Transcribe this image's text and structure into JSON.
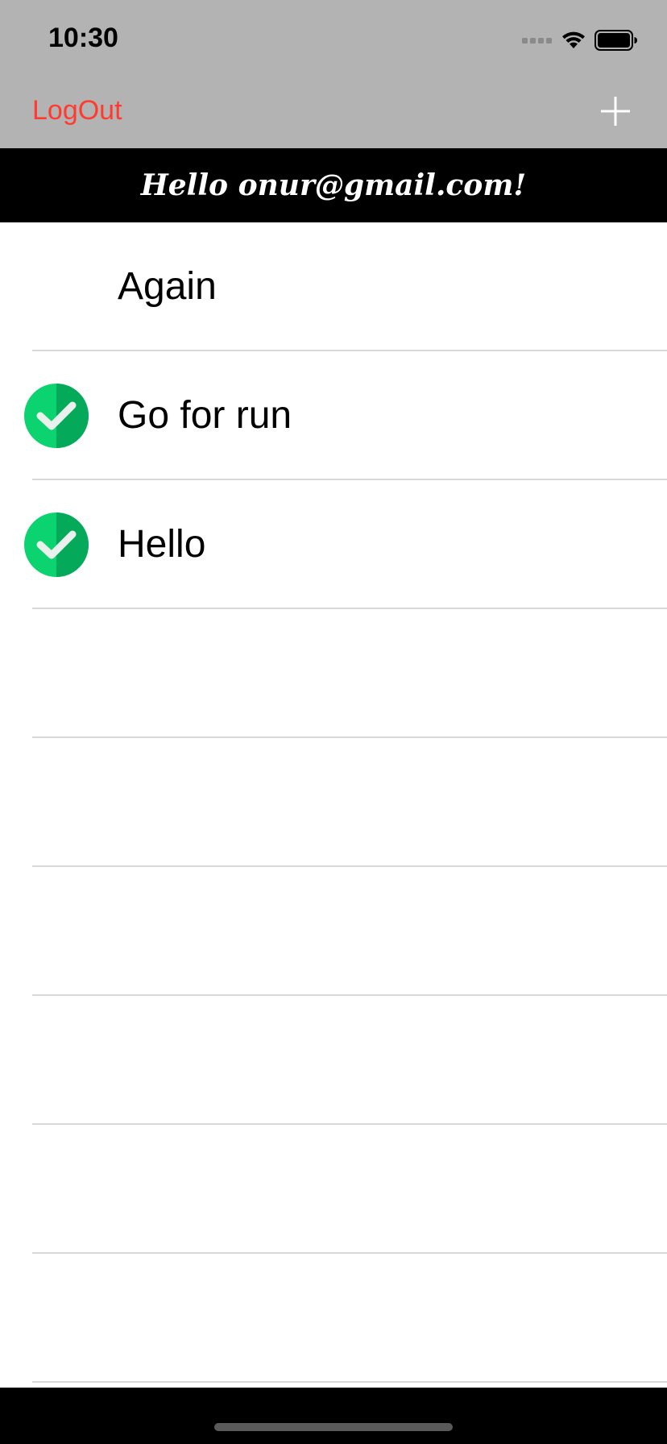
{
  "status_bar": {
    "time": "10:30"
  },
  "nav": {
    "left_label": "LogOut",
    "add_icon": "plus-icon"
  },
  "greeting": "Hello onur@gmail.com!",
  "colors": {
    "accent": "#ff3b30",
    "bar_gray": "#b3b3b3",
    "check_green": "#0bd36f",
    "check_green_dark": "#05a95a"
  },
  "todos": [
    {
      "title": "Again",
      "done": false
    },
    {
      "title": "Go for run",
      "done": true
    },
    {
      "title": "Hello",
      "done": true
    }
  ]
}
